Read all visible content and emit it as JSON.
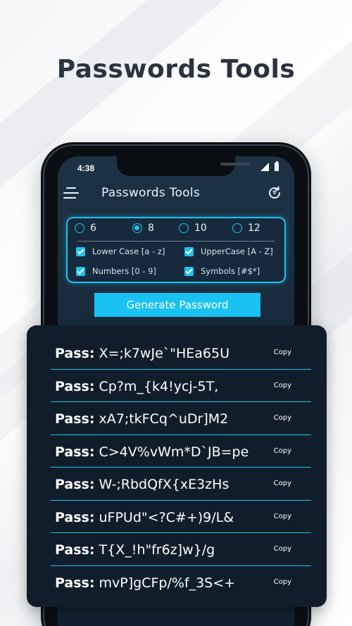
{
  "headline": "Passwords Tools",
  "status": {
    "time": "4:38"
  },
  "appbar": {
    "title": "Passwords Tools"
  },
  "length_options": [
    {
      "label": "6",
      "selected": false
    },
    {
      "label": "8",
      "selected": true
    },
    {
      "label": "10",
      "selected": false
    },
    {
      "label": "12",
      "selected": false
    }
  ],
  "char_options": [
    {
      "label": "Lower Case [a - z]",
      "checked": true
    },
    {
      "label": "UpperCase [A - Z]",
      "checked": true
    },
    {
      "label": "Numbers [0 - 9]",
      "checked": true
    },
    {
      "label": "Symbols [#$*]",
      "checked": true
    }
  ],
  "generate_label": "Generate Password",
  "pass_prefix": "Pass:",
  "copy_label": "Copy",
  "passwords": [
    "X=;k7wJe`\"HEa65U",
    "Cp?m_{k4!ycj-5T,",
    "xA7;tkFCq^uDr]M2",
    "C>4V%vWm*D`JB=pe",
    "W-;RbdQfX{xE3zHs",
    "uFPUd\"<?C#+)9/L&",
    "T{X_!h\"fr6z]w}/g",
    "mvP]gCFp/%f_3S<+"
  ],
  "colors": {
    "accent": "#1ec3f0",
    "panel": "#0f1e2a",
    "screen": "#1d3345",
    "headline": "#2a3340"
  }
}
